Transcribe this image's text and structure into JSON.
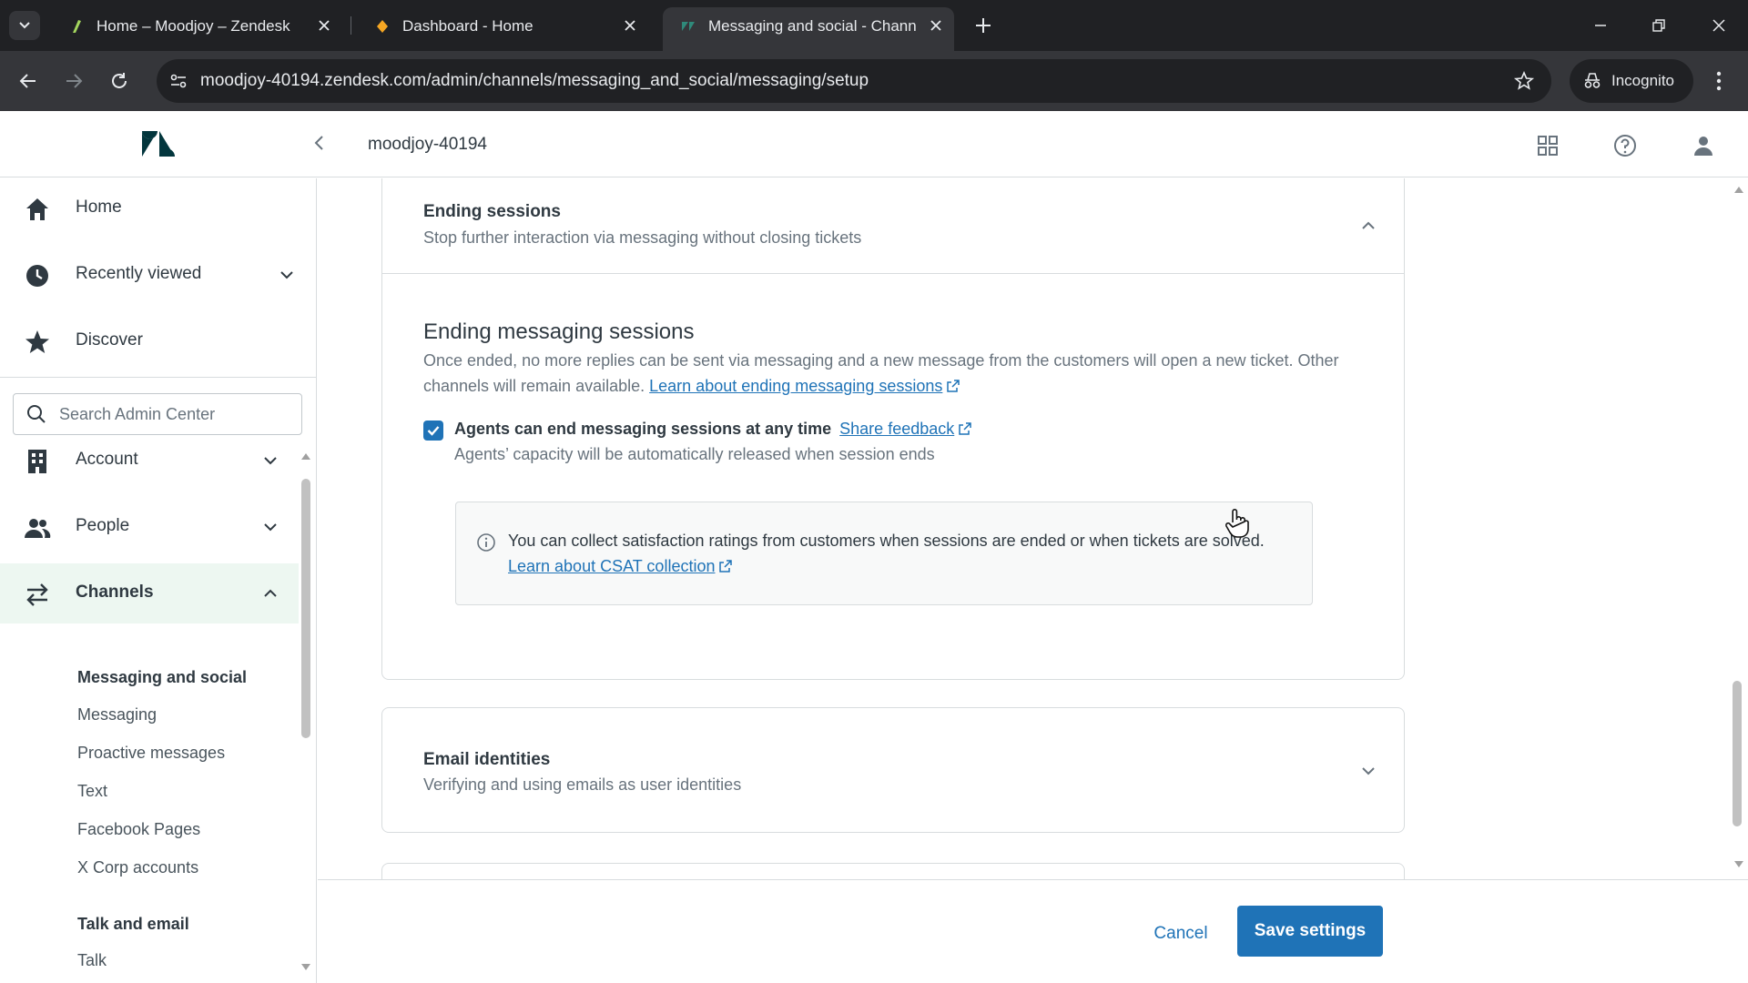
{
  "browser": {
    "tabs": [
      {
        "title": "Home – Moodjoy – Zendesk",
        "active": false
      },
      {
        "title": "Dashboard - Home",
        "active": false
      },
      {
        "title": "Messaging and social - Channe",
        "active": true
      }
    ],
    "url": "moodjoy-40194.zendesk.com/admin/channels/messaging_and_social/messaging/setup",
    "incognito_label": "Incognito"
  },
  "header": {
    "account_name": "moodjoy-40194"
  },
  "sidebar": {
    "top_items": [
      {
        "label": "Home",
        "icon": "home-icon"
      },
      {
        "label": "Recently viewed",
        "icon": "clock-icon"
      },
      {
        "label": "Discover",
        "icon": "star-icon"
      }
    ],
    "search_placeholder": "Search Admin Center",
    "sections": [
      {
        "label": "Account",
        "icon": "building-icon",
        "expanded": false
      },
      {
        "label": "People",
        "icon": "people-icon",
        "expanded": false
      },
      {
        "label": "Channels",
        "icon": "arrows-icon",
        "expanded": true
      }
    ],
    "channels_sub": {
      "group1_heading": "Messaging and social",
      "group1_items": [
        "Messaging",
        "Proactive messages",
        "Text",
        "Facebook Pages",
        "X Corp accounts"
      ],
      "group2_heading": "Talk and email",
      "group2_items": [
        "Talk"
      ]
    }
  },
  "main": {
    "ending_card": {
      "title": "Ending sessions",
      "subtitle": "Stop further interaction via messaging without closing tickets",
      "section_title": "Ending messaging sessions",
      "description": "Once ended, no more replies can be sent via messaging and a new message from the customers will open a new ticket. Other channels will remain available.",
      "description_link": "Learn about ending messaging sessions",
      "checkbox_label": "Agents can end messaging sessions at any time",
      "checkbox_checked": true,
      "feedback_link": "Share feedback",
      "checkbox_hint": "Agents’ capacity will be automatically released when session ends",
      "notice_text": "You can collect satisfaction ratings from customers when sessions are ended or when tickets are solved.",
      "notice_link": "Learn about CSAT collection"
    },
    "email_card": {
      "title": "Email identities",
      "subtitle": "Verifying and using emails as user identities"
    }
  },
  "footer": {
    "cancel_label": "Cancel",
    "save_label": "Save settings"
  },
  "colors": {
    "accent": "#1f73b7",
    "selected_nav_bg": "#edf7f1",
    "browser_dark": "#202124"
  }
}
